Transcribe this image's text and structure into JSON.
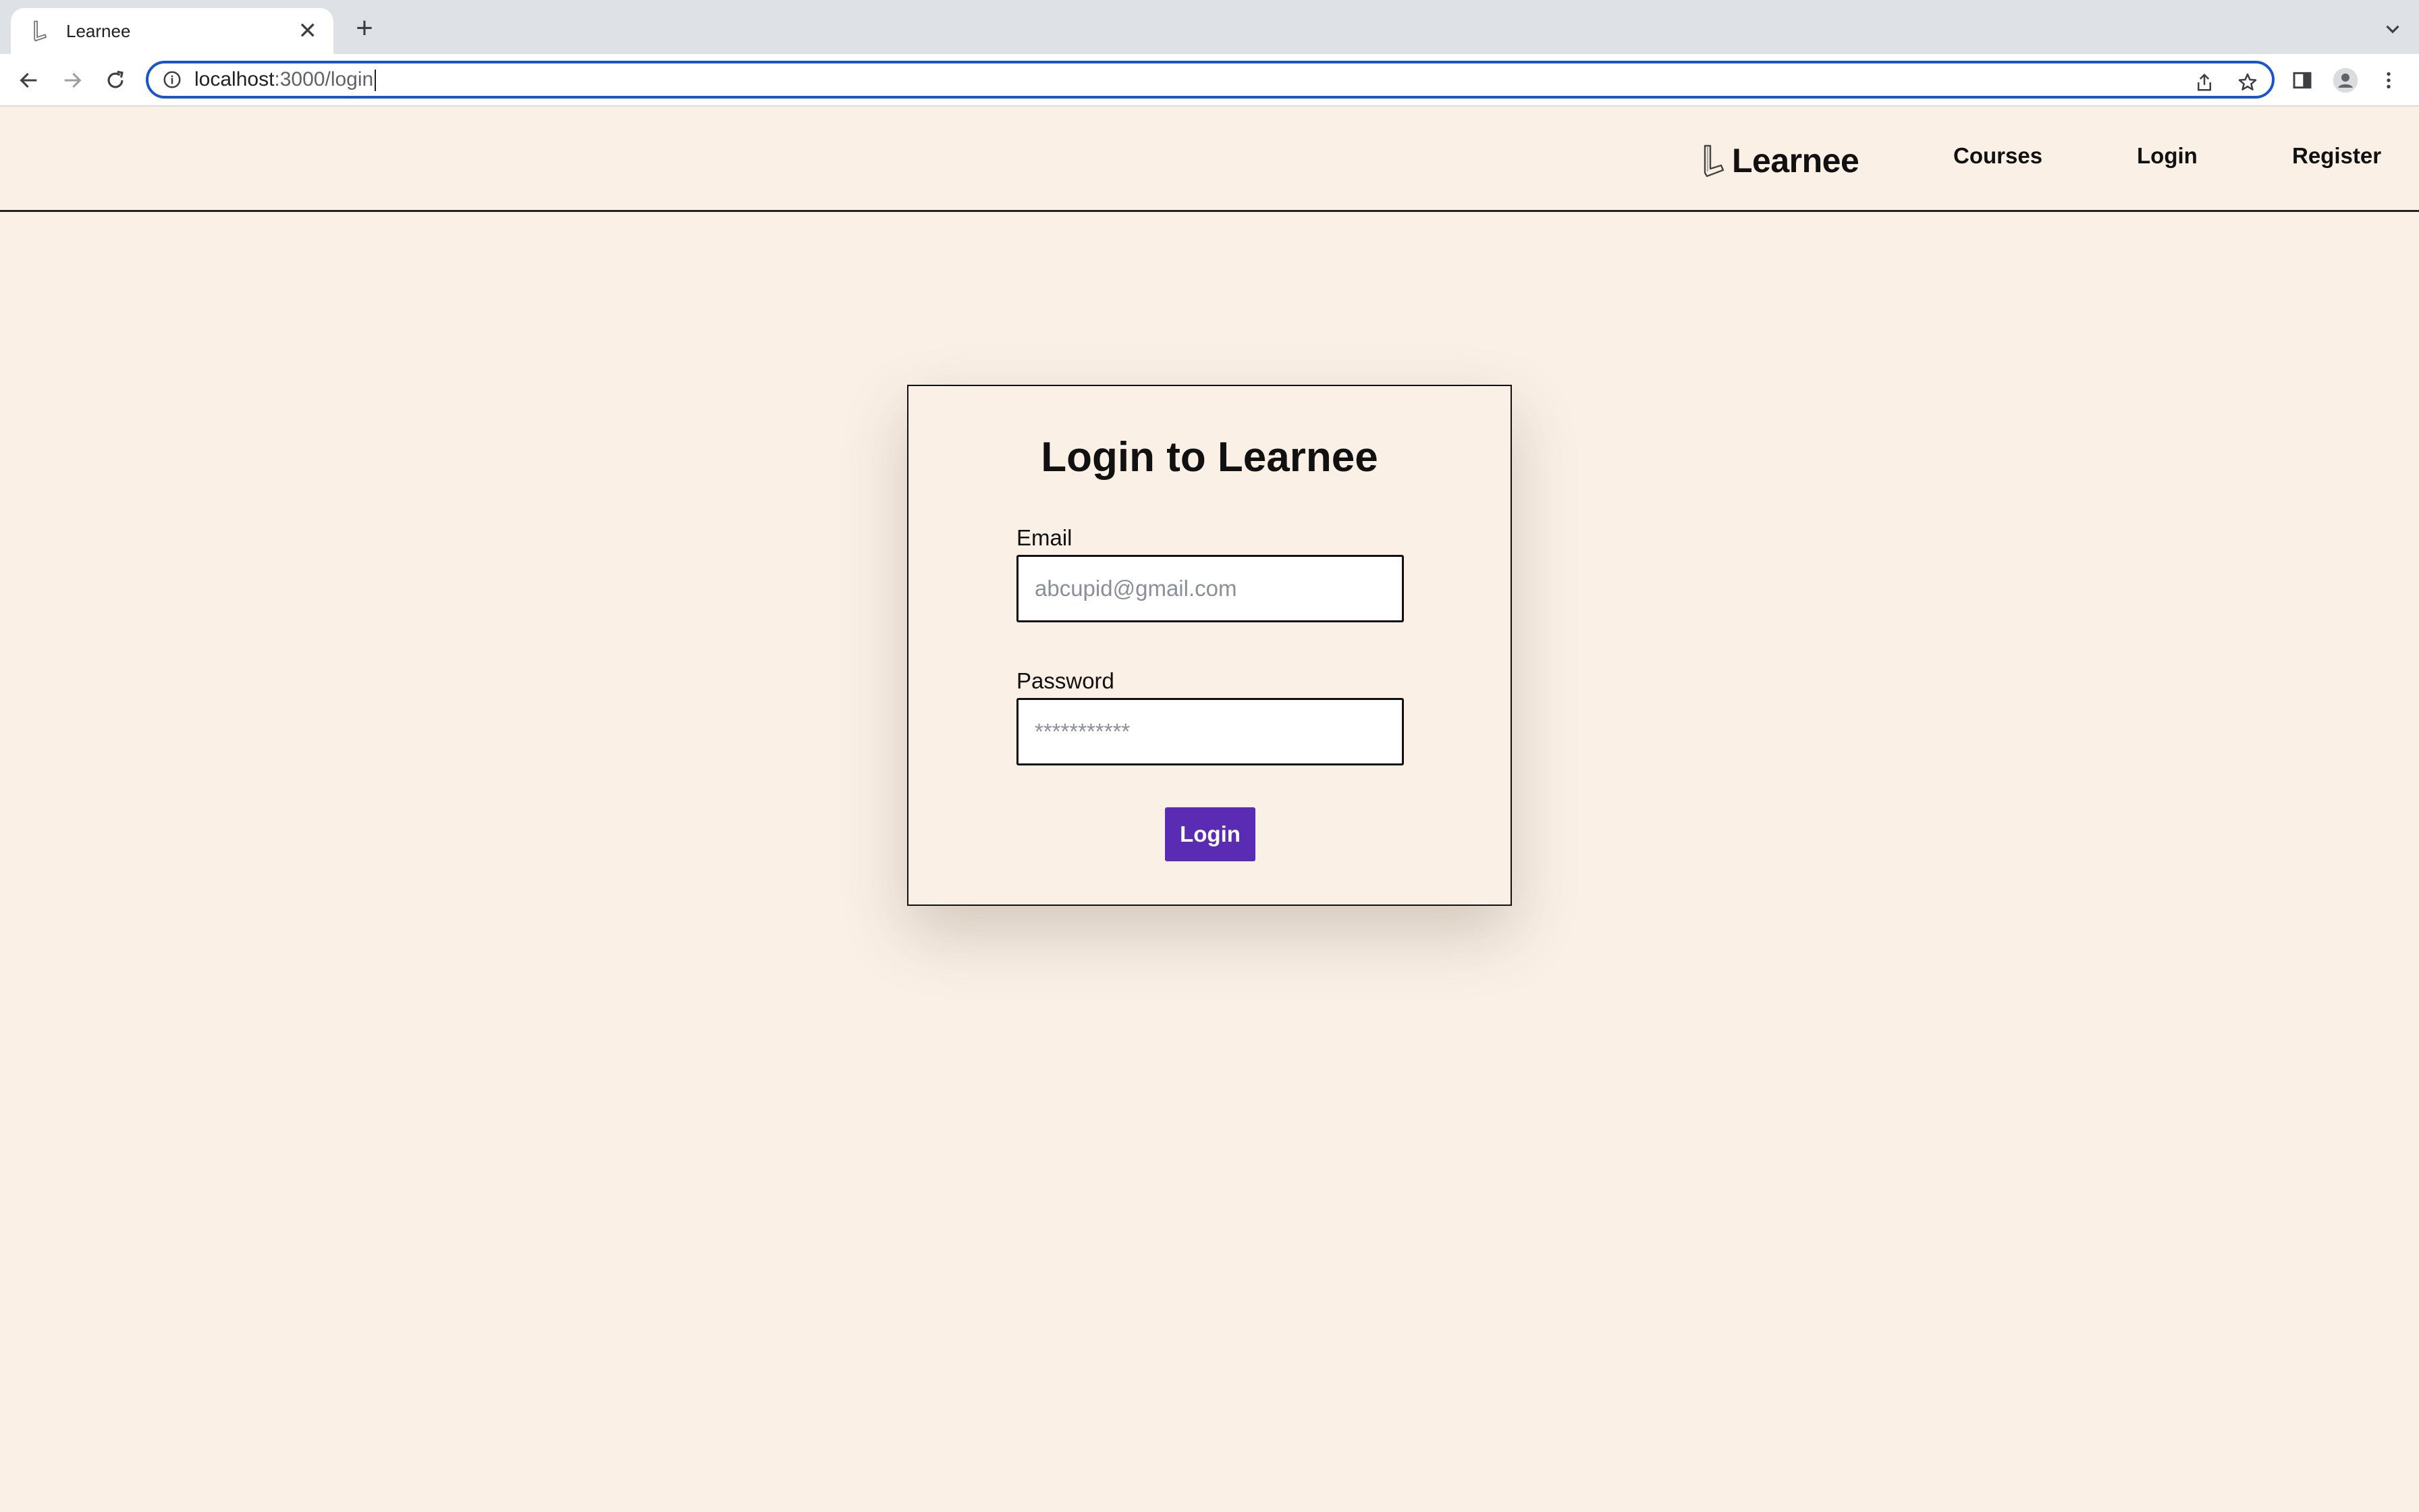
{
  "browser": {
    "tab_title": "Learnee",
    "new_tab_symbol": "+",
    "close_symbol": "✕",
    "url_host": "localhost",
    "url_path": ":3000/login"
  },
  "site": {
    "brand_name": "Learnee",
    "nav": {
      "courses": "Courses",
      "login": "Login",
      "register": "Register"
    }
  },
  "login_form": {
    "title": "Login to Learnee",
    "email_label": "Email",
    "email_placeholder": "abcupid@gmail.com",
    "email_value": "",
    "password_label": "Password",
    "password_placeholder": "***********",
    "password_value": "",
    "submit_label": "Login"
  },
  "colors": {
    "page_background": "#faf0e6",
    "primary_button": "#5a2bb3",
    "omnibox_focus": "#1a56c9"
  }
}
